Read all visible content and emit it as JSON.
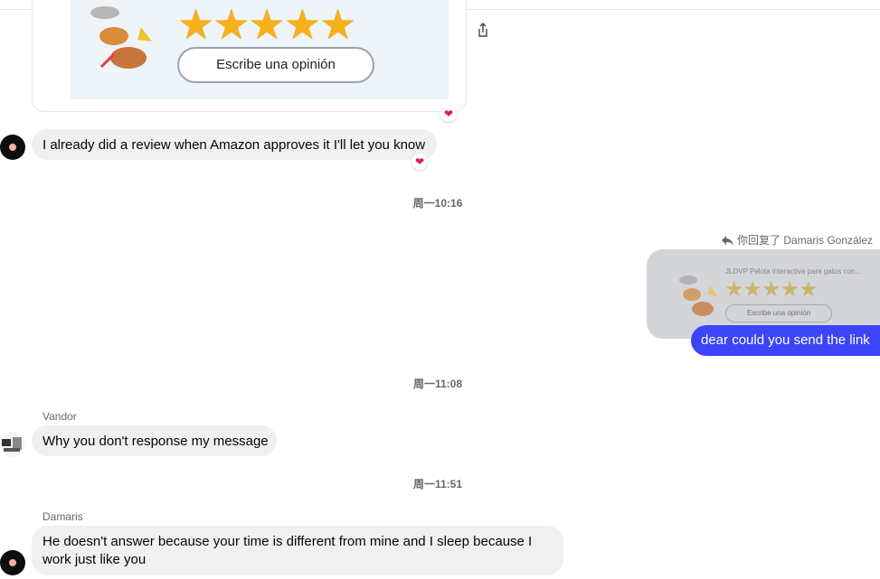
{
  "attachment": {
    "button_label": "Escribe una opinión",
    "stars": "★★★★★"
  },
  "messages": {
    "m1": {
      "text": "I already did a review when Amazon approves it I'll let you know"
    },
    "ts1": "周一10:16",
    "reply": {
      "label": "你回复了 Damaris González",
      "card_title": "JLDVP Pelota interactiva para gatos con...",
      "card_stars": "★★★★★",
      "card_button": "Escribe una opinión",
      "text": "dear could you send the link"
    },
    "ts2": "周一11:08",
    "m2": {
      "sender": "Vandor",
      "text": "Why you don't response my message"
    },
    "ts3": "周一11:51",
    "m3": {
      "sender": "Damaris",
      "text": "He doesn't answer because your time is different from mine and I sleep because I work just like you"
    }
  },
  "reaction": "❤"
}
